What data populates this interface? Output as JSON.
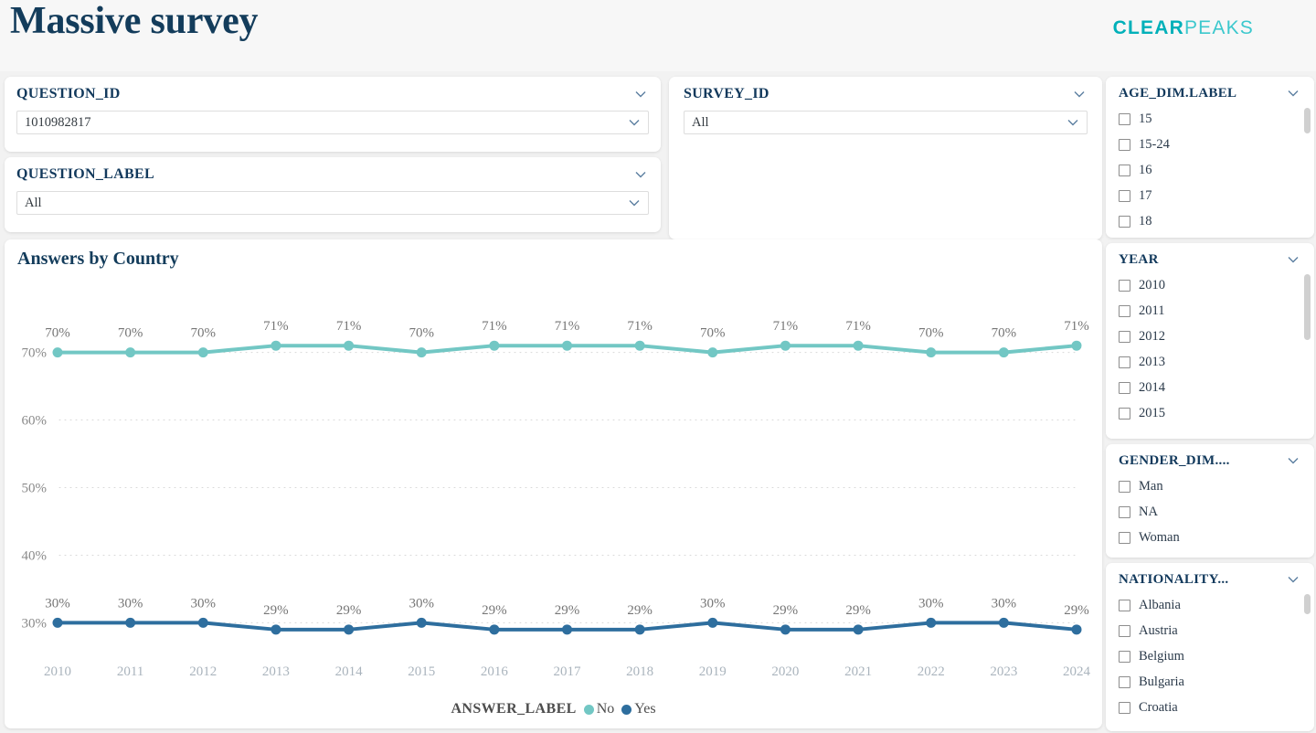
{
  "header": {
    "title": "Massive survey",
    "logo_clear": "CLEAR",
    "logo_peaks": "PEAKS",
    "accent_teal": "#00b0b9"
  },
  "filters": {
    "question_id": {
      "label": "QUESTION_ID",
      "value": "1010982817"
    },
    "question_label": {
      "label": "QUESTION_LABEL",
      "value": "All"
    },
    "survey_id": {
      "label": "SURVEY_ID",
      "value": "All"
    }
  },
  "sidebar": {
    "age": {
      "label": "AGE_DIM.LABEL",
      "options": [
        "15",
        "15-24",
        "16",
        "17",
        "18"
      ],
      "scrollbar": true
    },
    "year": {
      "label": "YEAR",
      "options": [
        "2010",
        "2011",
        "2012",
        "2013",
        "2014",
        "2015"
      ],
      "scrollbar": true
    },
    "gender": {
      "label": "GENDER_DIM....",
      "options": [
        "Man",
        "NA",
        "Woman"
      ],
      "scrollbar": false
    },
    "nationality": {
      "label": "NATIONALITY...",
      "options": [
        "Albania",
        "Austria",
        "Belgium",
        "Bulgaria",
        "Croatia"
      ],
      "scrollbar": true
    }
  },
  "chart_data": {
    "type": "line",
    "title": "Answers by Country",
    "xlabel": "",
    "ylabel": "",
    "legend_title": "ANSWER_LABEL",
    "legend_position": "bottom",
    "grid": true,
    "ylim": [
      26,
      74
    ],
    "yticks": [
      30,
      40,
      50,
      60,
      70
    ],
    "ytick_labels": [
      "30%",
      "40%",
      "50%",
      "60%",
      "70%"
    ],
    "categories": [
      "2010",
      "2011",
      "2012",
      "2013",
      "2014",
      "2015",
      "2016",
      "2017",
      "2018",
      "2019",
      "2020",
      "2021",
      "2022",
      "2023",
      "2024"
    ],
    "series": [
      {
        "name": "No",
        "color": "#72c7c4",
        "values": [
          70,
          70,
          70,
          71,
          71,
          70,
          71,
          71,
          71,
          70,
          71,
          71,
          70,
          70,
          71
        ],
        "labels": [
          "70%",
          "70%",
          "70%",
          "71%",
          "71%",
          "70%",
          "71%",
          "71%",
          "71%",
          "70%",
          "71%",
          "71%",
          "70%",
          "70%",
          "71%"
        ]
      },
      {
        "name": "Yes",
        "color": "#2e6e9e",
        "values": [
          30,
          30,
          30,
          29,
          29,
          30,
          29,
          29,
          29,
          30,
          29,
          29,
          30,
          30,
          29
        ],
        "labels": [
          "30%",
          "30%",
          "30%",
          "29%",
          "29%",
          "30%",
          "29%",
          "29%",
          "29%",
          "30%",
          "29%",
          "29%",
          "30%",
          "30%",
          "29%"
        ]
      }
    ]
  }
}
